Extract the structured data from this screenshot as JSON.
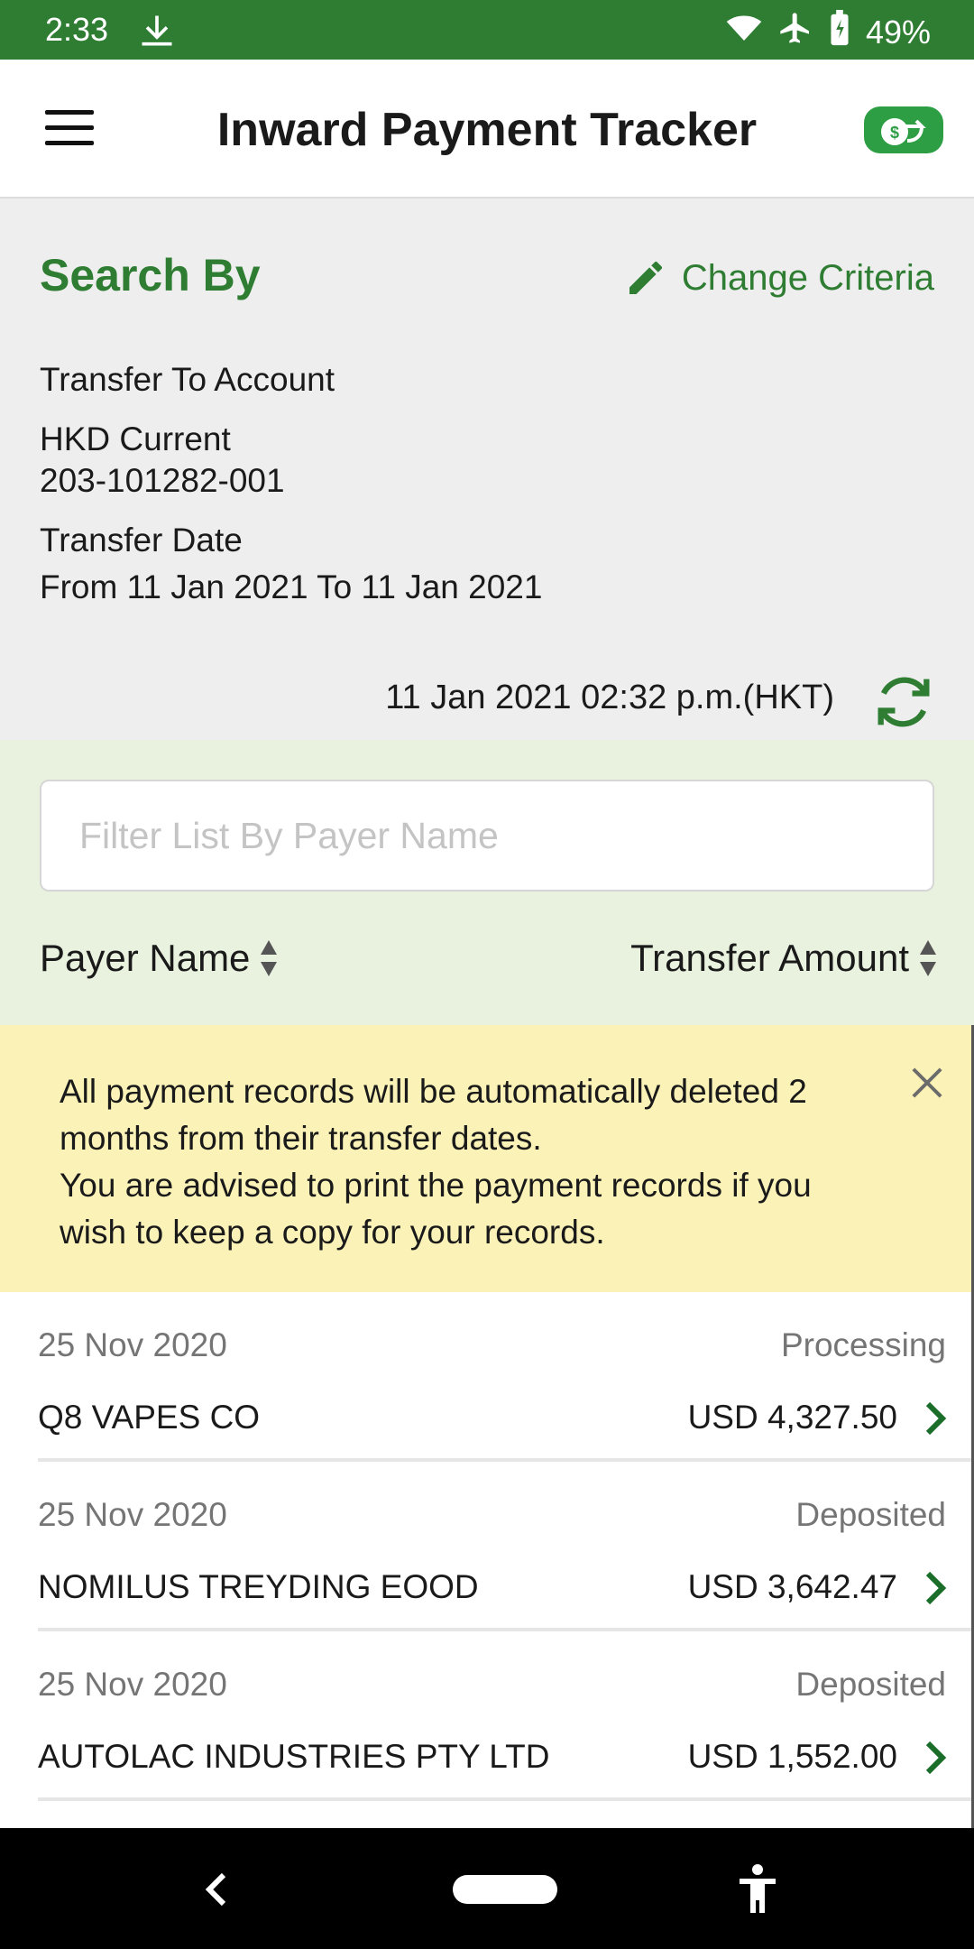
{
  "status_bar": {
    "time": "2:33",
    "battery": "49%"
  },
  "app_bar": {
    "title": "Inward Payment Tracker"
  },
  "search": {
    "title": "Search By",
    "change_label": "Change Criteria",
    "account_label": "Transfer To Account",
    "account_type": "HKD Current",
    "account_number": "203-101282-001",
    "date_label": "Transfer Date",
    "date_range": "From 11 Jan 2021 To 11 Jan 2021",
    "timestamp": "11 Jan 2021 02:32 p.m.(HKT)"
  },
  "filter": {
    "placeholder": "Filter List By Payer Name",
    "sort_payer": "Payer Name",
    "sort_amount": "Transfer Amount"
  },
  "notice": {
    "line1": "All payment records will be automatically deleted 2 months from their transfer dates.",
    "line2": "You are advised to print the payment records if you wish to keep a copy for your records."
  },
  "records": [
    {
      "date": "25 Nov 2020",
      "status": "Processing",
      "payer": "Q8 VAPES CO",
      "amount": "USD 4,327.50"
    },
    {
      "date": "25 Nov 2020",
      "status": "Deposited",
      "payer": "NOMILUS TREYDING EOOD",
      "amount": "USD 3,642.47"
    },
    {
      "date": "25 Nov 2020",
      "status": "Deposited",
      "payer": "AUTOLAC INDUSTRIES PTY LTD",
      "amount": "USD 1,552.00"
    }
  ],
  "colors": {
    "brand": "#2e7d32",
    "accent": "#2e9e45",
    "notice": "#fbf2b8",
    "filter_bg": "#e9f2df"
  },
  "icons": [
    "download-icon",
    "wifi-icon",
    "airplane-icon",
    "battery-icon",
    "menu-icon",
    "money-transfer-icon",
    "pencil-icon",
    "refresh-icon",
    "sort-icon",
    "close-icon",
    "chevron-right-icon",
    "back-icon",
    "accessibility-icon"
  ]
}
